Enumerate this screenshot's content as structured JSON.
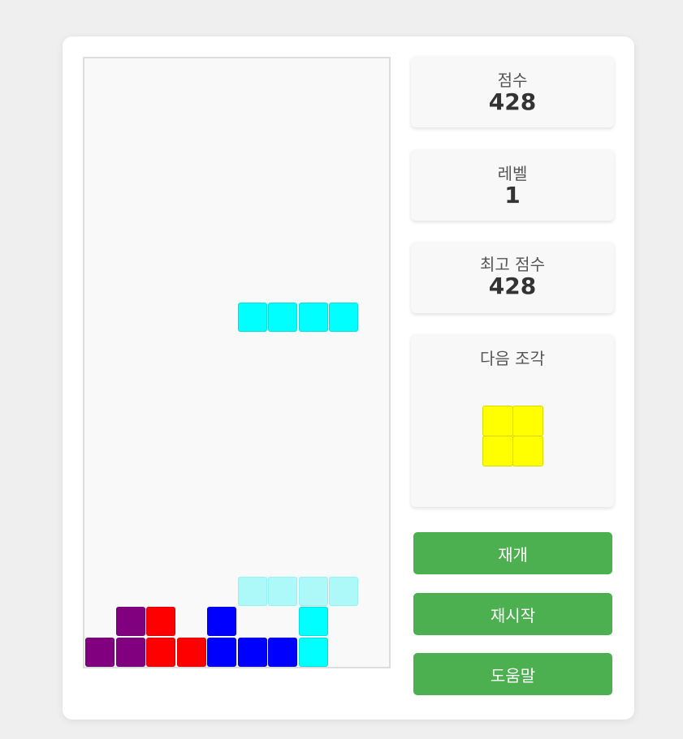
{
  "stats": {
    "score_label": "점수",
    "score_value": "428",
    "level_label": "레벨",
    "level_value": "1",
    "high_score_label": "최고 점수",
    "high_score_value": "428",
    "next_label": "다음 조각"
  },
  "buttons": {
    "resume": "재개",
    "restart": "재시작",
    "help": "도움말"
  },
  "colors": {
    "I": "#00ffff",
    "O": "#ffff00",
    "T": "#800080",
    "Z": "#ff0000",
    "J": "#0000ff",
    "ghost": "#adf9f9",
    "button": "#4caf50"
  },
  "board": {
    "cols": 10,
    "rows": 20,
    "active_piece": {
      "type": "I",
      "cells": [
        [
          5,
          8
        ],
        [
          6,
          8
        ],
        [
          7,
          8
        ],
        [
          8,
          8
        ]
      ]
    },
    "ghost_piece": {
      "type": "ghost",
      "cells": [
        [
          5,
          17
        ],
        [
          6,
          17
        ],
        [
          7,
          17
        ],
        [
          8,
          17
        ]
      ]
    },
    "locked_cells": [
      {
        "type": "T",
        "cells": [
          [
            1,
            18
          ],
          [
            0,
            19
          ],
          [
            1,
            19
          ]
        ]
      },
      {
        "type": "Z",
        "cells": [
          [
            2,
            18
          ],
          [
            2,
            19
          ],
          [
            3,
            19
          ]
        ]
      },
      {
        "type": "J",
        "cells": [
          [
            4,
            18
          ],
          [
            4,
            19
          ],
          [
            5,
            19
          ],
          [
            6,
            19
          ]
        ]
      },
      {
        "type": "I",
        "cells": [
          [
            7,
            18
          ],
          [
            7,
            19
          ]
        ]
      }
    ]
  },
  "next_piece": {
    "type": "O",
    "cells": [
      [
        0,
        0
      ],
      [
        1,
        0
      ],
      [
        0,
        1
      ],
      [
        1,
        1
      ]
    ]
  }
}
